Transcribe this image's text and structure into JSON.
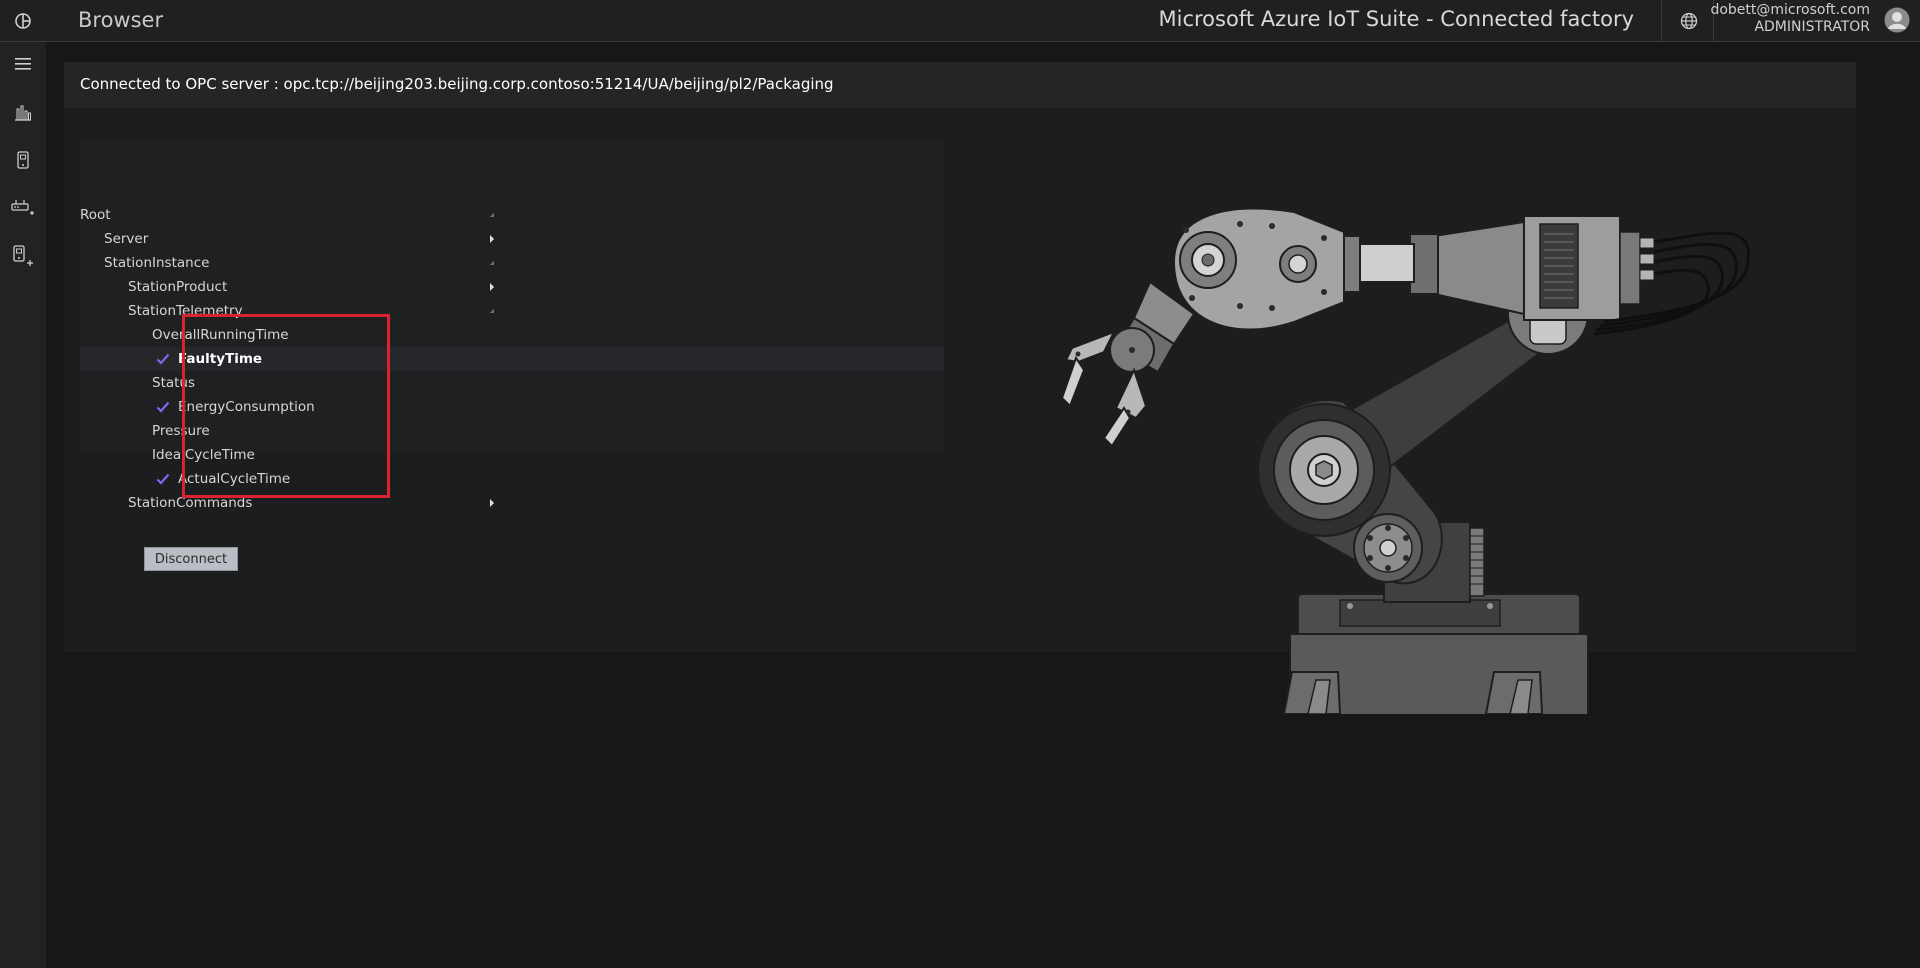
{
  "header": {
    "page_title": "Browser",
    "suite_title": "Microsoft Azure IoT Suite - Connected factory",
    "user_email": "dobett@microsoft.com",
    "user_role": "ADMINISTRATOR"
  },
  "sidebar": {
    "items": [
      {
        "icon": "hamburger-menu-icon"
      },
      {
        "icon": "bar-chart-icon"
      },
      {
        "icon": "device-icon"
      },
      {
        "icon": "add-gateway-icon"
      },
      {
        "icon": "add-device-icon"
      }
    ]
  },
  "connection": {
    "text": "Connected to OPC server : opc.tcp://beijing203.beijing.corp.contoso:51214/UA/beijing/pl2/Packaging"
  },
  "tree": {
    "nodes": [
      {
        "label": "Root"
      },
      {
        "label": "Server"
      },
      {
        "label": "StationInstance"
      },
      {
        "label": "StationProduct"
      },
      {
        "label": "StationTelemetry"
      },
      {
        "label": "OverallRunningTime"
      },
      {
        "label": "FaultyTime",
        "checked": true
      },
      {
        "label": "Status"
      },
      {
        "label": "EnergyConsumption",
        "checked": true
      },
      {
        "label": "Pressure"
      },
      {
        "label": "IdealCycleTime"
      },
      {
        "label": "ActualCycleTime",
        "checked": true
      },
      {
        "label": "StationCommands"
      }
    ]
  },
  "actions": {
    "disconnect_label": "Disconnect"
  },
  "colors": {
    "check_accent": "#7b68ee",
    "highlight_border": "#d9232e",
    "background": "#161719"
  }
}
